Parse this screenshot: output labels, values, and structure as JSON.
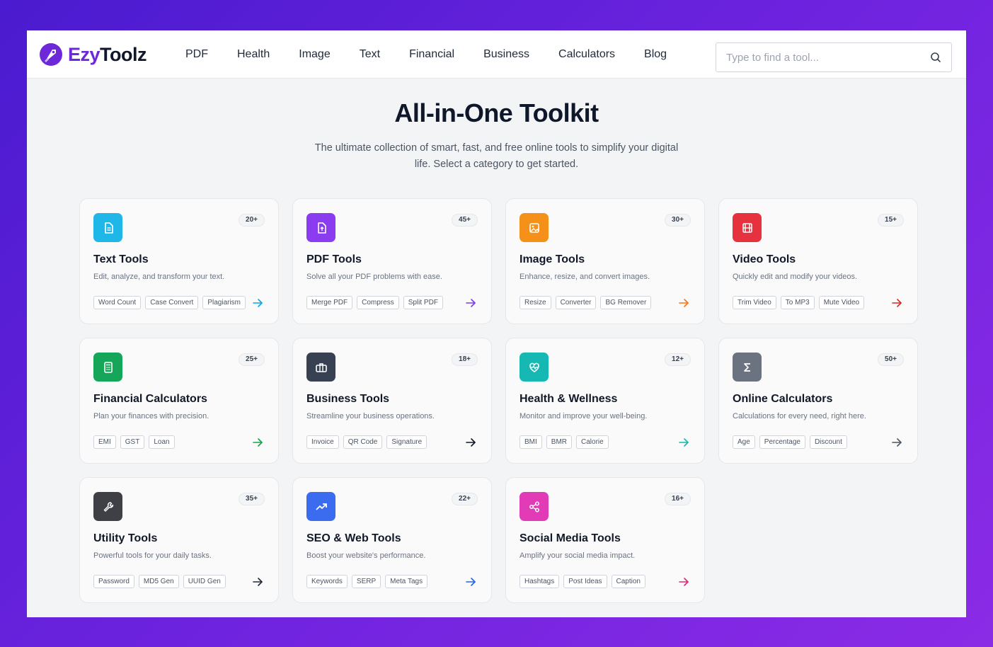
{
  "brand": {
    "part1": "Ezy",
    "part2": "Toolz"
  },
  "nav": [
    "PDF",
    "Health",
    "Image",
    "Text",
    "Financial",
    "Business",
    "Calculators",
    "Blog"
  ],
  "search": {
    "placeholder": "Type to find a tool..."
  },
  "hero": {
    "title": "All-in-One Toolkit",
    "subtitle": "The ultimate collection of smart, fast, and free online tools to simplify your digital life. Select a category to get started."
  },
  "cards": [
    {
      "title": "Text Tools",
      "desc": "Edit, analyze, and transform your text.",
      "count": "20+",
      "tags": [
        "Word Count",
        "Case Convert",
        "Plagiarism"
      ],
      "icon": "document-icon",
      "color": "#1fb6e8",
      "arrow_color": "#0ea5e9"
    },
    {
      "title": "PDF Tools",
      "desc": "Solve all your PDF problems with ease.",
      "count": "45+",
      "tags": [
        "Merge PDF",
        "Compress",
        "Split PDF"
      ],
      "icon": "pdf-icon",
      "color": "#8b3cf0",
      "arrow_color": "#7c3aed"
    },
    {
      "title": "Image Tools",
      "desc": "Enhance, resize, and convert images.",
      "count": "30+",
      "tags": [
        "Resize",
        "Converter",
        "BG Remover"
      ],
      "icon": "image-icon",
      "color": "#f59118",
      "arrow_color": "#f97316"
    },
    {
      "title": "Video Tools",
      "desc": "Quickly edit and modify your videos.",
      "count": "15+",
      "tags": [
        "Trim Video",
        "To MP3",
        "Mute Video"
      ],
      "icon": "film-icon",
      "color": "#e5323e",
      "arrow_color": "#dc2626"
    },
    {
      "title": "Financial Calculators",
      "desc": "Plan your finances with precision.",
      "count": "25+",
      "tags": [
        "EMI",
        "GST",
        "Loan"
      ],
      "icon": "calculator-icon",
      "color": "#16a659",
      "arrow_color": "#16a34a"
    },
    {
      "title": "Business Tools",
      "desc": "Streamline your business operations.",
      "count": "18+",
      "tags": [
        "Invoice",
        "QR Code",
        "Signature"
      ],
      "icon": "briefcase-icon",
      "color": "#374151",
      "arrow_color": "#111827"
    },
    {
      "title": "Health & Wellness",
      "desc": "Monitor and improve your well-being.",
      "count": "12+",
      "tags": [
        "BMI",
        "BMR",
        "Calorie"
      ],
      "icon": "heart-pulse-icon",
      "color": "#15b8b2",
      "arrow_color": "#14b8a6"
    },
    {
      "title": "Online Calculators",
      "desc": "Calculations for every need, right here.",
      "count": "50+",
      "tags": [
        "Age",
        "Percentage",
        "Discount"
      ],
      "icon": "sigma-icon",
      "color": "#6b7280",
      "arrow_color": "#4b5563"
    },
    {
      "title": "Utility Tools",
      "desc": "Powerful tools for your daily tasks.",
      "count": "35+",
      "tags": [
        "Password",
        "MD5 Gen",
        "UUID Gen"
      ],
      "icon": "wrench-icon",
      "color": "#3f3f46",
      "arrow_color": "#1f2937"
    },
    {
      "title": "SEO & Web Tools",
      "desc": "Boost your website's performance.",
      "count": "22+",
      "tags": [
        "Keywords",
        "SERP",
        "Meta Tags"
      ],
      "icon": "trending-up-icon",
      "color": "#3b6cf0",
      "arrow_color": "#2563eb"
    },
    {
      "title": "Social Media Tools",
      "desc": "Amplify your social media impact.",
      "count": "16+",
      "tags": [
        "Hashtags",
        "Post Ideas",
        "Caption"
      ],
      "icon": "share-icon",
      "color": "#e13bb8",
      "arrow_color": "#db2777"
    }
  ]
}
